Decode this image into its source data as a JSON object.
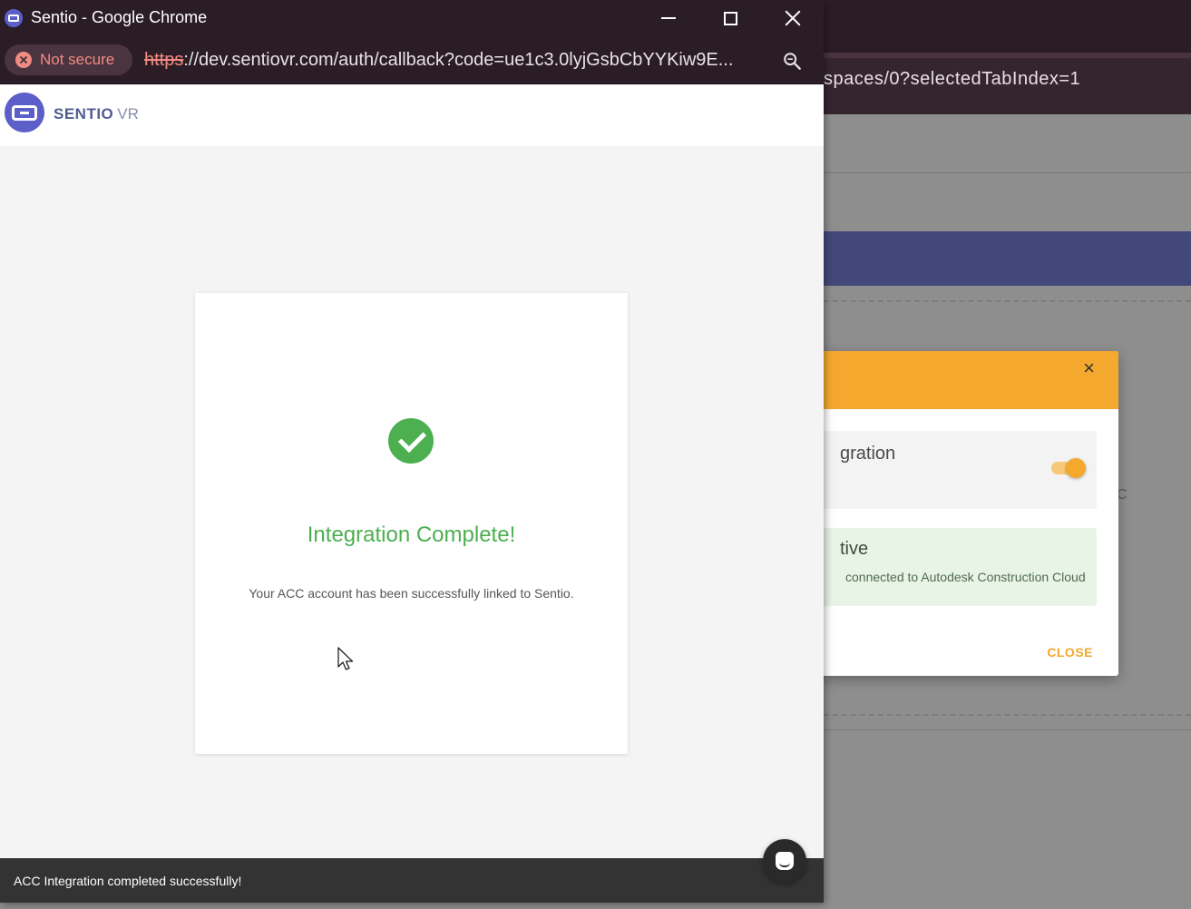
{
  "popup": {
    "window_title": "Sentio - Google Chrome",
    "security_label": "Not secure",
    "url_scheme": "https",
    "url_rest": "://dev.sentiovr.com/auth/callback?code=ue1c3.0lyjGsbCbYYKiw9E...",
    "brand_primary": "SENTIO",
    "brand_secondary": "VR",
    "card_title": "Integration Complete!",
    "card_message": "Your ACC account has been successfully linked to Sentio.",
    "snackbar_message": "ACC Integration completed successfully!"
  },
  "background": {
    "url_fragment": "spaces/0?selectedTabIndex=1",
    "side_char": "C",
    "dialog": {
      "close_glyph": "×",
      "card1_title": "gration",
      "card2_title": "tive",
      "card2_subtitle": "connected to Autodesk Construction Cloud",
      "action_label": "CLOSE"
    }
  },
  "colors": {
    "success": "#4caf50",
    "accent": "#f4a82e",
    "brand": "#5b5fc7",
    "danger": "#f28b82"
  }
}
